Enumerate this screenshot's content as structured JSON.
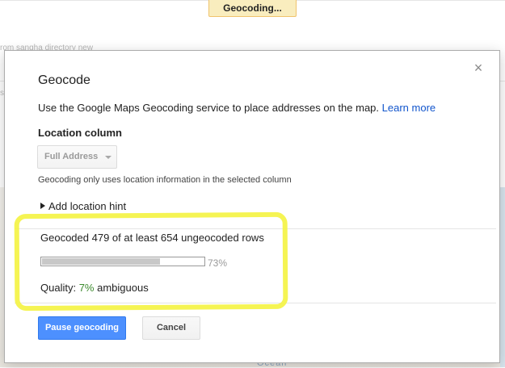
{
  "background": {
    "breadcrumb_fragment": "rom sangha directory new",
    "left_fragment": "s",
    "map_label": "Ocean"
  },
  "toast": {
    "text": "Geocoding..."
  },
  "dialog": {
    "title": "Geocode",
    "close_glyph": "×",
    "intro_text": "Use the Google Maps Geocoding service to place addresses on the map.",
    "learn_more": "Learn more",
    "location_column_label": "Location column",
    "location_column_value": "Full Address",
    "location_note": "Geocoding only uses location information in the selected column",
    "add_location_hint": "Add location hint",
    "progress": {
      "text": "Geocoded 479 of at least 654 ungeocoded rows",
      "fraction": 0.73,
      "percent_text": "73%"
    },
    "quality": {
      "label": "Quality:",
      "value": "7%",
      "suffix": "ambiguous"
    },
    "buttons": {
      "pause": "Pause geocoding",
      "cancel": "Cancel"
    }
  },
  "colors": {
    "accent": "#4d90fe",
    "link": "#1155cc",
    "highlight": "#f4f34a",
    "quality_value": "#3c8a2e"
  }
}
